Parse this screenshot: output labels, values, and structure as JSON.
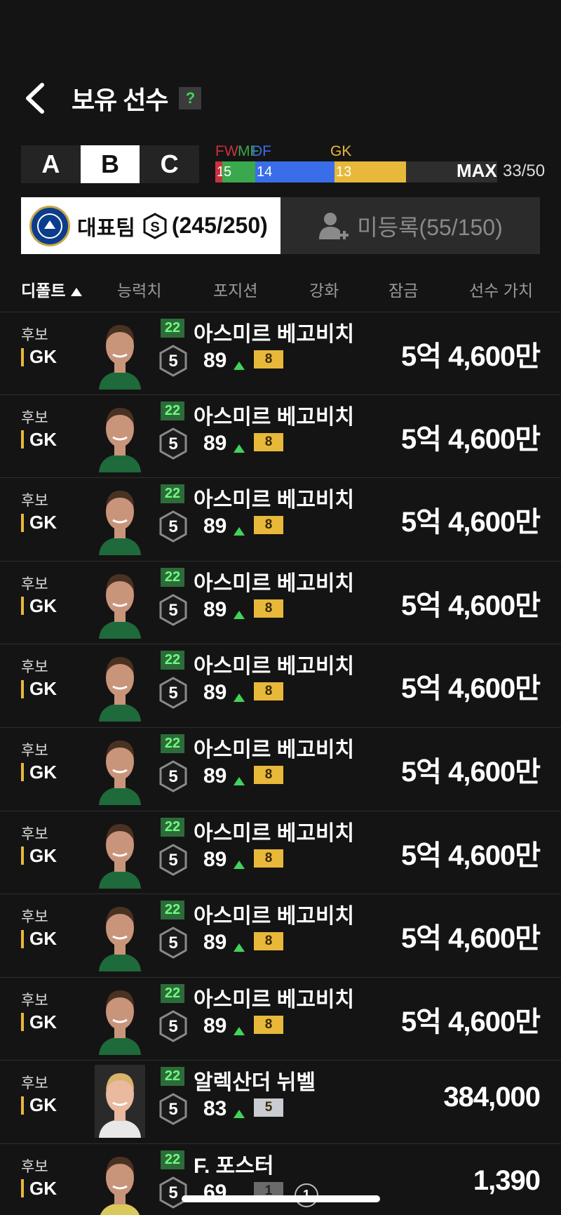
{
  "header": {
    "title": "보유 선수",
    "help": "?"
  },
  "squad_tabs": [
    "A",
    "B",
    "C"
  ],
  "squad_active": "B",
  "positions": {
    "labels": {
      "fw": "FW",
      "mf": "MF",
      "df": "DF",
      "gk": "GK"
    },
    "counts": {
      "fw": "1",
      "mf": "5",
      "df": "14",
      "gk": "13"
    },
    "colors": {
      "fw": "#c8323c",
      "mf": "#3aa84c",
      "df": "#3a6ee8",
      "gk": "#e8b83a"
    },
    "max_label": "MAX",
    "total": "33/50"
  },
  "team_tabs": {
    "main_name": "대표팀",
    "main_count": "(245/250)",
    "unregistered": "미등록(55/150)"
  },
  "sort_header": {
    "default": "디폴트",
    "ability": "능력치",
    "position": "포지션",
    "enhance": "강화",
    "lock": "잠금",
    "value": "선수 가치"
  },
  "players": [
    {
      "status": "후보",
      "pos": "GK",
      "season": "22",
      "name": "아스미르 베고비치",
      "level": "5",
      "ovr": "89",
      "grade": "8",
      "grade_color": "gold",
      "value": "5억 4,600만"
    },
    {
      "status": "후보",
      "pos": "GK",
      "season": "22",
      "name": "아스미르 베고비치",
      "level": "5",
      "ovr": "89",
      "grade": "8",
      "grade_color": "gold",
      "value": "5억 4,600만"
    },
    {
      "status": "후보",
      "pos": "GK",
      "season": "22",
      "name": "아스미르 베고비치",
      "level": "5",
      "ovr": "89",
      "grade": "8",
      "grade_color": "gold",
      "value": "5억 4,600만"
    },
    {
      "status": "후보",
      "pos": "GK",
      "season": "22",
      "name": "아스미르 베고비치",
      "level": "5",
      "ovr": "89",
      "grade": "8",
      "grade_color": "gold",
      "value": "5억 4,600만"
    },
    {
      "status": "후보",
      "pos": "GK",
      "season": "22",
      "name": "아스미르 베고비치",
      "level": "5",
      "ovr": "89",
      "grade": "8",
      "grade_color": "gold",
      "value": "5억 4,600만"
    },
    {
      "status": "후보",
      "pos": "GK",
      "season": "22",
      "name": "아스미르 베고비치",
      "level": "5",
      "ovr": "89",
      "grade": "8",
      "grade_color": "gold",
      "value": "5억 4,600만"
    },
    {
      "status": "후보",
      "pos": "GK",
      "season": "22",
      "name": "아스미르 베고비치",
      "level": "5",
      "ovr": "89",
      "grade": "8",
      "grade_color": "gold",
      "value": "5억 4,600만"
    },
    {
      "status": "후보",
      "pos": "GK",
      "season": "22",
      "name": "아스미르 베고비치",
      "level": "5",
      "ovr": "89",
      "grade": "8",
      "grade_color": "gold",
      "value": "5억 4,600만"
    },
    {
      "status": "후보",
      "pos": "GK",
      "season": "22",
      "name": "아스미르 베고비치",
      "level": "5",
      "ovr": "89",
      "grade": "8",
      "grade_color": "gold",
      "value": "5억 4,600만"
    },
    {
      "status": "후보",
      "pos": "GK",
      "season": "22",
      "name": "알렉산더 뉘벨",
      "level": "5",
      "ovr": "83",
      "grade": "5",
      "grade_color": "silver",
      "value": "384,000"
    },
    {
      "status": "후보",
      "pos": "GK",
      "season": "22",
      "name": "F. 포스터",
      "level": "5",
      "ovr": "69",
      "grade": "1",
      "grade_color": "gray",
      "value": "1,390",
      "extra": "1"
    }
  ]
}
